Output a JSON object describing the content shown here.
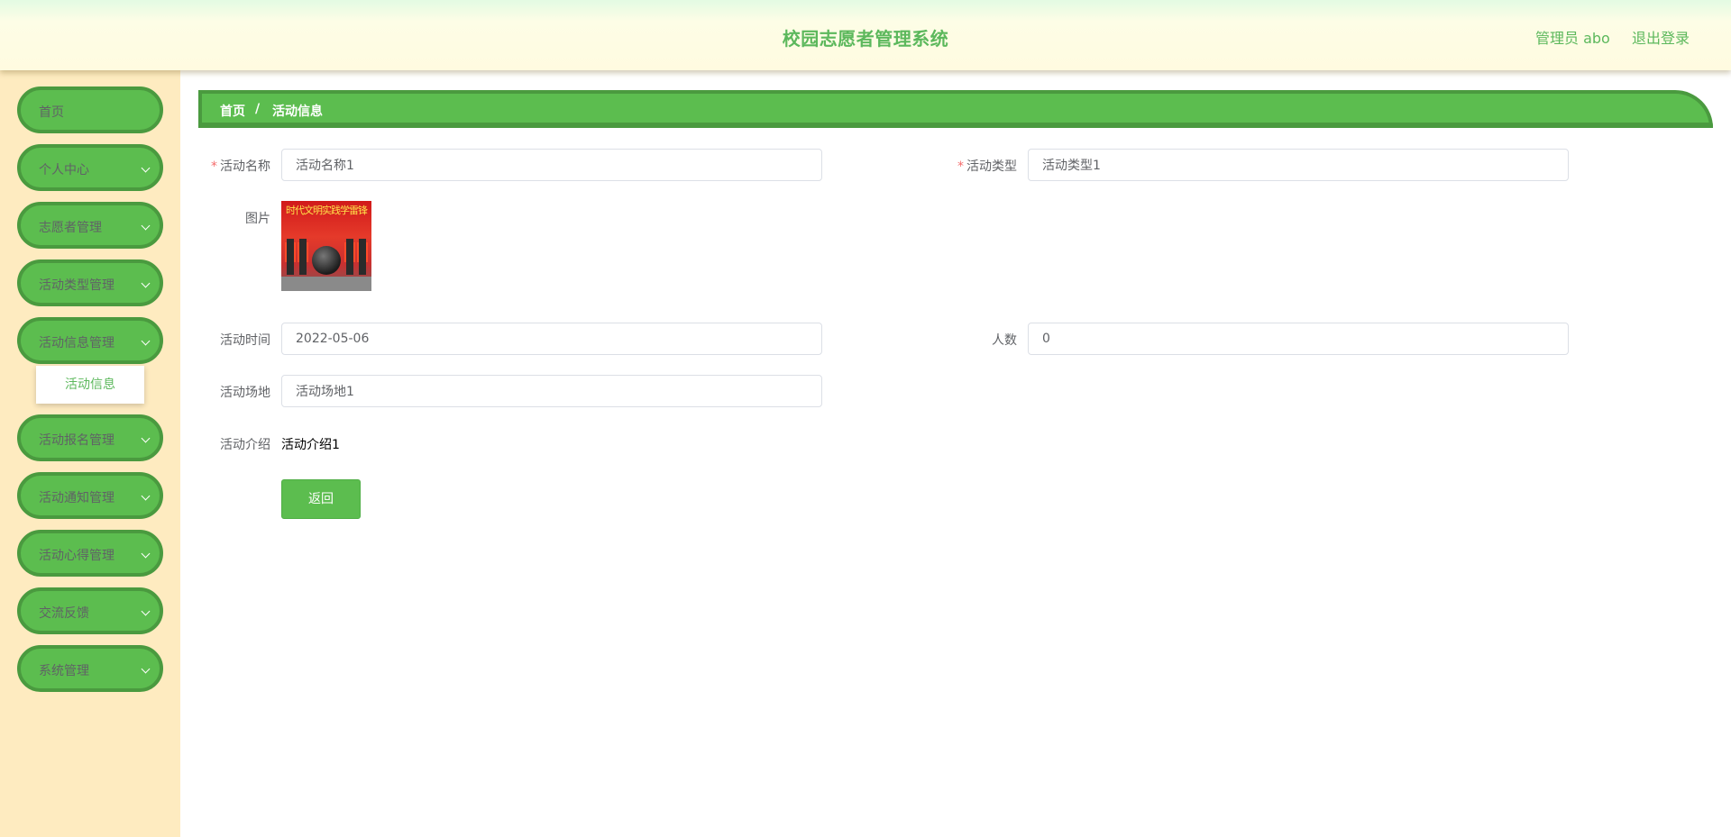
{
  "header": {
    "title": "校园志愿者管理系统",
    "user": "管理员 abo",
    "logout": "退出登录"
  },
  "sidebar": {
    "items": [
      {
        "label": "首页",
        "has_children": false
      },
      {
        "label": "个人中心",
        "has_children": true
      },
      {
        "label": "志愿者管理",
        "has_children": true
      },
      {
        "label": "活动类型管理",
        "has_children": true
      },
      {
        "label": "活动信息管理",
        "has_children": true,
        "expanded": true
      },
      {
        "label": "活动报名管理",
        "has_children": true
      },
      {
        "label": "活动通知管理",
        "has_children": true
      },
      {
        "label": "活动心得管理",
        "has_children": true
      },
      {
        "label": "交流反馈",
        "has_children": true
      },
      {
        "label": "系统管理",
        "has_children": true
      }
    ],
    "submenu": {
      "label": "活动信息"
    }
  },
  "breadcrumb": {
    "home": "首页",
    "separator": "/",
    "current": "活动信息"
  },
  "form": {
    "activity_name": {
      "label": "活动名称",
      "value": "活动名称1",
      "required": true
    },
    "activity_type": {
      "label": "活动类型",
      "value": "活动类型1",
      "required": true
    },
    "picture": {
      "label": "图片",
      "banner_text": "时代文明实践学雷锋"
    },
    "activity_time": {
      "label": "活动时间",
      "value": "2022-05-06"
    },
    "people_count": {
      "label": "人数",
      "value": "0"
    },
    "venue": {
      "label": "活动场地",
      "value": "活动场地1"
    },
    "intro": {
      "label": "活动介绍",
      "value": "活动介绍1"
    },
    "back_button": "返回"
  },
  "colors": {
    "accent": "#5cbd4f",
    "accent_border": "#4a9a3f",
    "sidebar_bg": "#feebc0",
    "required_mark": "#f56c6c"
  }
}
